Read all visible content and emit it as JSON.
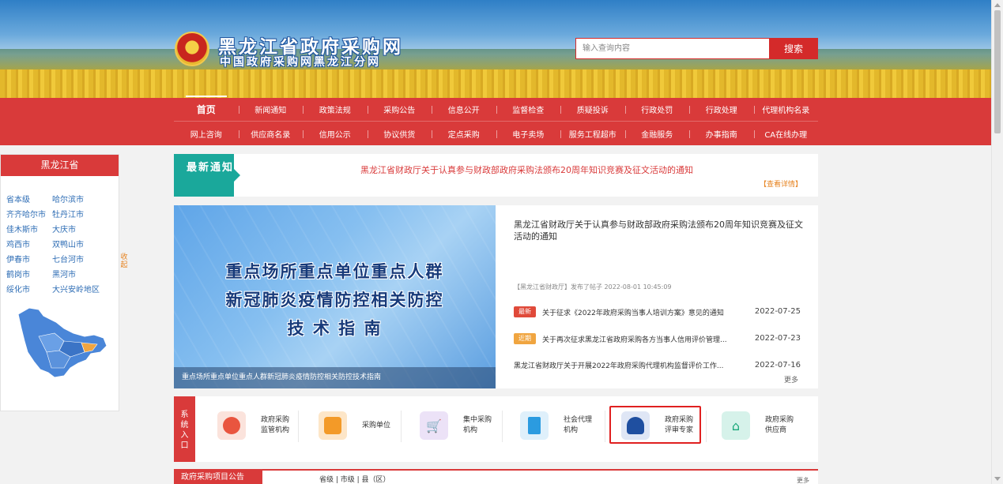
{
  "header": {
    "title": "黑龙江省政府采购网",
    "subtitle": "中国政府采购网黑龙江分网",
    "search_placeholder": "输入查询内容",
    "search_button": "搜索"
  },
  "nav": {
    "row1": [
      "首页",
      "新闻通知",
      "政策法规",
      "采购公告",
      "信息公开",
      "监督检查",
      "质疑投诉",
      "行政处罚",
      "行政处理",
      "代理机构名录"
    ],
    "row2": [
      "网上咨询",
      "供应商名录",
      "信用公示",
      "协议供货",
      "定点采购",
      "电子卖场",
      "服务工程超市",
      "金融服务",
      "办事指南",
      "CA在线办理"
    ]
  },
  "region": {
    "title": "黑龙江省",
    "items": [
      "省本级",
      "哈尔滨市",
      "齐齐哈尔市",
      "牡丹江市",
      "佳木斯市",
      "大庆市",
      "鸡西市",
      "双鸭山市",
      "伊春市",
      "七台河市",
      "鹤岗市",
      "黑河市",
      "绥化市",
      "大兴安岭地区"
    ],
    "collapse": "收起"
  },
  "notice": {
    "badge": "最新通知",
    "text": "黑龙江省财政厅关于认真参与财政部政府采购法颁布20周年知识竞赛及征文活动的通知",
    "more": "【查看详情】"
  },
  "slide": {
    "line1": "重点场所重点单位重点人群",
    "line2": "新冠肺炎疫情防控相关防控",
    "line3": "技 术 指 南",
    "caption": "重点场所重点单位重点人群新冠肺炎疫情防控相关防控技术指南"
  },
  "news": {
    "headline": "黑龙江省财政厅关于认真参与财政部政府采购法颁布20周年知识竞赛及征文活动的通知",
    "meta": "【黑龙江省财政厅】发布了帖子 2022-08-01 10:45:09",
    "items": [
      {
        "tag": "最新",
        "title": "关于征求《2022年政府采购当事人培训方案》意见的通知",
        "date": "2022-07-25"
      },
      {
        "tag": "近期",
        "title": "关于再次征求黑龙江省政府采购各方当事人信用评价管理...",
        "date": "2022-07-23"
      },
      {
        "tag": "",
        "title": "黑龙江省财政厅关于开展2022年政府采购代理机构监督评价工作...",
        "date": "2022-07-16"
      }
    ],
    "more": "更多"
  },
  "system": {
    "label": "系统入口",
    "entries": [
      {
        "label": "政府采购\n监管机构",
        "icon": "supervision-icon"
      },
      {
        "label": "采购单位",
        "icon": "purchaser-icon"
      },
      {
        "label": "集中采购\n机构",
        "icon": "cart-icon"
      },
      {
        "label": "社会代理\n机构",
        "icon": "building-icon"
      },
      {
        "label": "政府采购\n评审专家",
        "icon": "expert-icon"
      },
      {
        "label": "政府采购\n供应商",
        "icon": "supplier-icon"
      }
    ]
  },
  "projects": {
    "title": "政府采购项目公告",
    "tabs": "省级 | 市级 | 县（区）",
    "more": "更多"
  },
  "colors": {
    "brand_red": "#d93a3a",
    "teal": "#1aa89b",
    "link_blue": "#2e6db5",
    "accent_orange": "#e6821e"
  }
}
